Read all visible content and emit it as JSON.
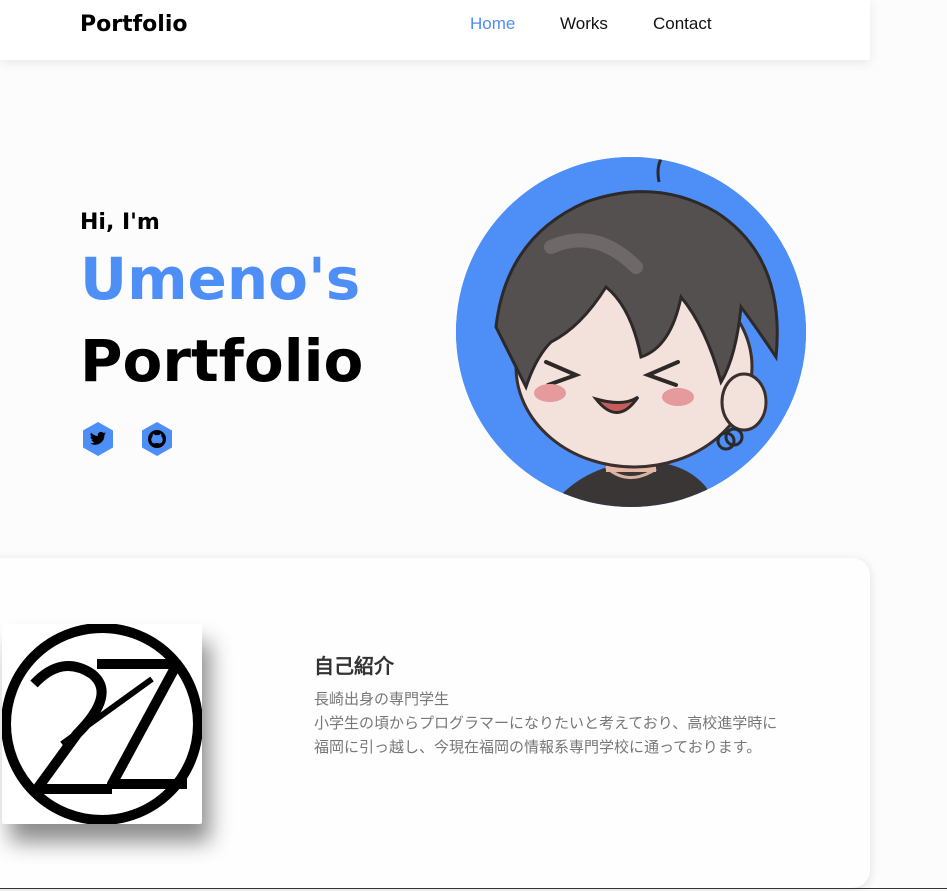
{
  "header": {
    "brand": "Portfolio",
    "nav": [
      {
        "label": "Home"
      },
      {
        "label": "Works"
      },
      {
        "label": "Contact"
      }
    ]
  },
  "hero": {
    "greeting": "Hi, I'm",
    "name": "Umeno's",
    "title": "Portfolio",
    "social": [
      "twitter-icon",
      "github-icon"
    ]
  },
  "about": {
    "title": "自己紹介",
    "lines": [
      "長崎出身の専門学生",
      "小学生の頃からプログラマーになりたいと考えており、高校進学時に",
      "福岡に引っ越し、今現在福岡の情報系専門学校に通っております。"
    ]
  },
  "colors": {
    "accent": "#4d8ef7",
    "text": "#000000",
    "muted": "#777777"
  }
}
